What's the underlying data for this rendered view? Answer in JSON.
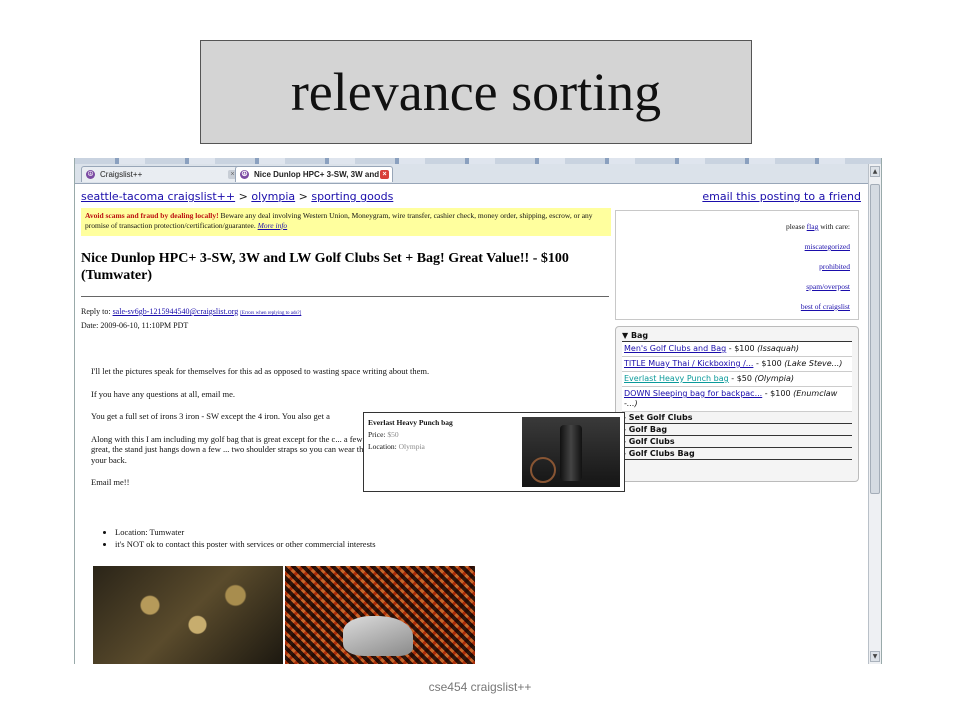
{
  "slide": {
    "title": "relevance sorting",
    "footer": "cse454 craigslist++"
  },
  "browser": {
    "tabs": [
      {
        "label": "Craigslist++"
      },
      {
        "label": "Nice Dunlop HPC+ 3-SW, 3W and ..."
      }
    ]
  },
  "page": {
    "breadcrumb": {
      "site": "seattle-tacoma craigslist++",
      "sep1": " > ",
      "city": "olympia",
      "sep2": " > ",
      "category": "sporting goods"
    },
    "email_link": "email this posting to a friend",
    "warning": {
      "bold": "Avoid scams and fraud by dealing locally!",
      "text": " Beware any deal involving Western Union, Moneygram, wire transfer, cashier check, money order, shipping, escrow, or any promise of transaction protection/certification/guarantee. ",
      "more": "More info"
    },
    "post_title": "Nice Dunlop HPC+ 3-SW, 3W and LW Golf Clubs Set + Bag! Great Value!! - $100 (Tumwater)",
    "reply_label": "Reply to: ",
    "reply_email": "sale-sv6gb-1215944540@craigslist.org",
    "reply_note": "[Errors when replying to ads?]",
    "date": "Date: 2009-06-10, 11:10PM PDT",
    "body": [
      "I'll let the pictures speak for themselves for this ad as opposed to wasting space writing about them.",
      "If you have any questions at all, email me.",
      "You get a full set of irons 3 iron - SW except the 4 iron. You also get a",
      "Along with this I am including my golf bag that is great except for the c... a few years back. It still works great, the stand just hangs down a few ... two shoulder straps so you can wear the clubs comfortably on your back.",
      "Email me!!"
    ],
    "bullets": [
      "Location: Tumwater",
      "it's NOT ok to contact this poster with services or other commercial interests"
    ],
    "flag": {
      "lead": "please ",
      "flag_word": "flag",
      "tail": " with care:",
      "options": [
        "miscategorized",
        "prohibited",
        "spam/overpost",
        "best of craigslist"
      ]
    },
    "related": {
      "header": "▼ Bag",
      "results": [
        {
          "title": "Men's Golf Clubs and Bag",
          "price": " - $100 ",
          "location": "(Issaquah)"
        },
        {
          "title": "TITLE Muay Thai / Kickboxing /...",
          "price": " - $100 ",
          "location": "(Lake Steve...)"
        },
        {
          "title": "Everlast Heavy Punch bag",
          "price": " - $50 ",
          "location": "(Olympia)"
        },
        {
          "title": "DOWN Sleeping bag for backpac...",
          "price": " - $100 ",
          "location": "(Enumclaw -...)"
        }
      ],
      "categories": [
        "▸ Set Golf Clubs",
        "▸ Golf Bag",
        "▸ Golf Clubs",
        "▸ Golf Clubs Bag"
      ]
    },
    "popup": {
      "title": "Everlast Heavy Punch bag",
      "price_label": "Price: ",
      "price": "$50",
      "location_label": "Location: ",
      "location": "Olympia"
    }
  }
}
